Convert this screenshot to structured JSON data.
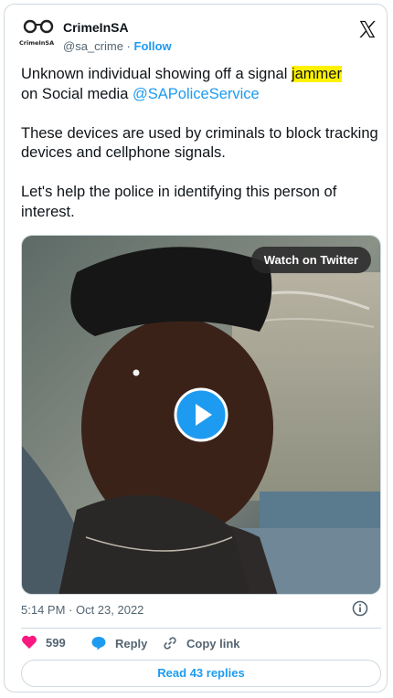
{
  "account": {
    "logo_text": "CrimeInSA",
    "name": "CrimeInSA",
    "handle": "@sa_crime",
    "separator": " · ",
    "follow_label": "Follow"
  },
  "tweet": {
    "line1_before": "Unknown individual showing off a signal ",
    "highlight": "jammer",
    "line2_before": "on Social media ",
    "mention": "@SAPoliceService",
    "paragraph2": "These devices are used by criminals to block tracking devices  and cellphone signals.",
    "paragraph3": "Let's help the police in identifying this person of interest."
  },
  "media": {
    "watch_label": "Watch on Twitter",
    "play_icon": "play-icon"
  },
  "meta": {
    "timestamp": "5:14 PM · Oct 23, 2022"
  },
  "actions": {
    "likes": "599",
    "reply_label": "Reply",
    "copy_label": "Copy link"
  },
  "replies_button": "Read 43 replies",
  "colors": {
    "accent": "#1d9bf0",
    "like": "#f91880",
    "highlight": "#fff200"
  }
}
